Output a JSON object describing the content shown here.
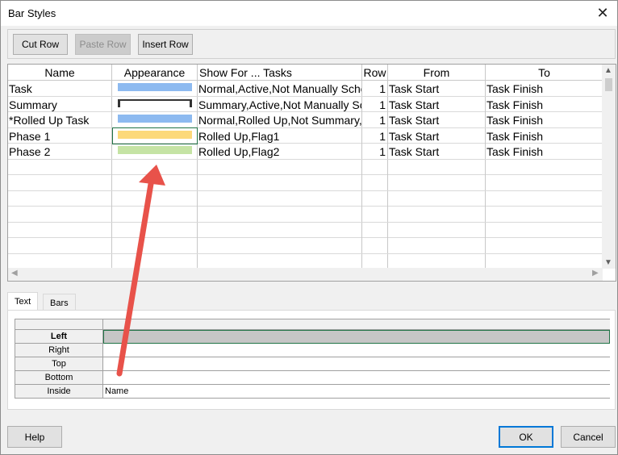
{
  "window": {
    "title": "Bar Styles"
  },
  "toolbar": {
    "cut_row": "Cut Row",
    "paste_row": "Paste Row",
    "insert_row": "Insert Row"
  },
  "grid": {
    "columns": [
      "Name",
      "Appearance",
      "Show For ... Tasks",
      "Row",
      "From",
      "To"
    ],
    "rows": [
      {
        "name": "Task",
        "appearance_color": "#8dbaf0",
        "show_for": "Normal,Active,Not Manually Sched",
        "row": "1",
        "from": "Task Start",
        "to": "Task Finish"
      },
      {
        "name": "Summary",
        "appearance_color": "#333333",
        "show_for": "Summary,Active,Not Manually Sch",
        "row": "1",
        "from": "Task Start",
        "to": "Task Finish"
      },
      {
        "name": "*Rolled Up Task",
        "appearance_color": "#8dbaf0",
        "show_for": "Normal,Rolled Up,Not Summary,N",
        "row": "1",
        "from": "Task Start",
        "to": "Task Finish"
      },
      {
        "name": "Phase 1",
        "appearance_color": "#fcd97a",
        "show_for": "Rolled Up,Flag1",
        "row": "1",
        "from": "Task Start",
        "to": "Task Finish"
      },
      {
        "name": "Phase 2",
        "appearance_color": "#c5e3a4",
        "show_for": "Rolled Up,Flag2",
        "row": "1",
        "from": "Task Start",
        "to": "Task Finish"
      }
    ]
  },
  "tabs": {
    "text": "Text",
    "bars": "Bars"
  },
  "text_grid": {
    "rows": [
      {
        "label": "Left",
        "value": ""
      },
      {
        "label": "Right",
        "value": ""
      },
      {
        "label": "Top",
        "value": ""
      },
      {
        "label": "Bottom",
        "value": ""
      },
      {
        "label": "Inside",
        "value": "Name"
      }
    ]
  },
  "footer": {
    "help": "Help",
    "ok": "OK",
    "cancel": "Cancel"
  },
  "colors": {
    "annotation_arrow": "#e8524a",
    "selection": "#217346"
  }
}
